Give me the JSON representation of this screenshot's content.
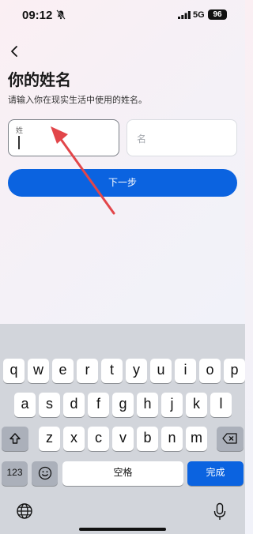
{
  "status_bar": {
    "time": "09:12",
    "network": "5G",
    "battery": "96"
  },
  "page": {
    "title": "你的姓名",
    "subtitle": "请输入你在现实生活中使用的姓名。",
    "last_name_label": "姓",
    "first_name_placeholder": "名",
    "next_label": "下一步"
  },
  "keyboard": {
    "row1": [
      "q",
      "w",
      "e",
      "r",
      "t",
      "y",
      "u",
      "i",
      "o",
      "p"
    ],
    "row2": [
      "a",
      "s",
      "d",
      "f",
      "g",
      "h",
      "j",
      "k",
      "l"
    ],
    "row3": [
      "z",
      "x",
      "c",
      "v",
      "b",
      "n",
      "m"
    ],
    "numbers_label": "123",
    "space_label": "空格",
    "return_label": "完成"
  },
  "colors": {
    "accent": "#0b63e0",
    "annotation_arrow": "#e2464a"
  }
}
